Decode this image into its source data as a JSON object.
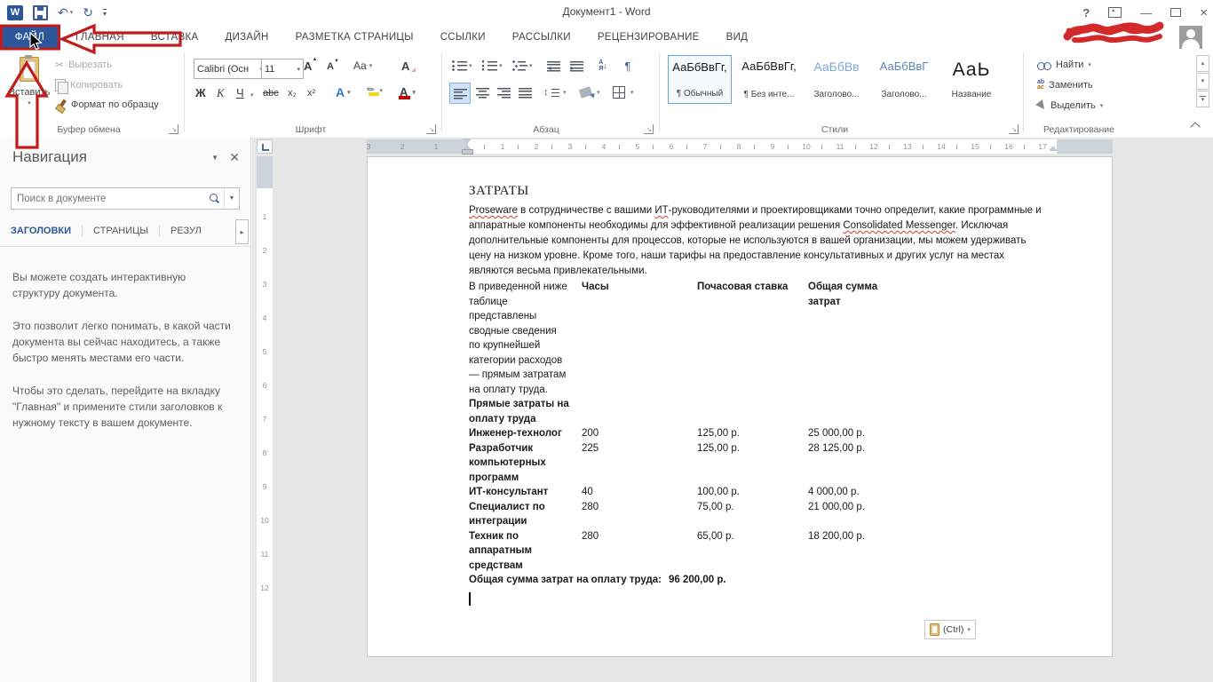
{
  "titlebar": {
    "title": "Документ1 - Word",
    "help": "?"
  },
  "tabs": {
    "file": "ФАЙЛ",
    "items": [
      "ГЛАВНАЯ",
      "ВСТАВКА",
      "ДИЗАЙН",
      "РАЗМЕТКА СТРАНИЦЫ",
      "ССЫЛКИ",
      "РАССЫЛКИ",
      "РЕЦЕНЗИРОВАНИЕ",
      "ВИД"
    ]
  },
  "ribbon": {
    "clipboard": {
      "paste": "Вставить",
      "cut": "Вырезать",
      "copy": "Копировать",
      "format_painter": "Формат по образцу",
      "group": "Буфер обмена"
    },
    "font": {
      "name": "Calibri (Осн",
      "size": "11",
      "bold": "Ж",
      "italic": "К",
      "underline": "Ч",
      "strike": "abc",
      "subscript": "x₂",
      "superscript": "x²",
      "change_case": "Aa",
      "grow": "А",
      "shrink": "А",
      "clear": "А",
      "effects": "А",
      "color_letter": "А",
      "group": "Шрифт"
    },
    "paragraph": {
      "group": "Абзац",
      "pilcrow": "¶",
      "sort_a": "А",
      "sort_b": "Я"
    },
    "styles": {
      "group": "Стили",
      "items": [
        {
          "preview": "АаБбВвГг,",
          "name": "¶ Обычный"
        },
        {
          "preview": "АаБбВвГг,",
          "name": "¶ Без инте..."
        },
        {
          "preview": "АаБбВв",
          "name": "Заголово..."
        },
        {
          "preview": "АаБбВвГ",
          "name": "Заголово..."
        },
        {
          "preview": "АаЬ",
          "name": "Название"
        }
      ]
    },
    "editing": {
      "find": "Найти",
      "replace": "Заменить",
      "select": "Выделить",
      "group": "Редактирование"
    }
  },
  "navigation": {
    "title": "Навигация",
    "search_placeholder": "Поиск в документе",
    "tabs": [
      "ЗАГОЛОВКИ",
      "СТРАНИЦЫ",
      "РЕЗУЛ"
    ],
    "paragraphs": [
      "Вы можете создать интерактивную структуру документа.",
      "Это позволит легко понимать, в какой части документа вы сейчас находитесь, а также быстро менять местами его части.",
      "Чтобы это сделать, перейдите на вкладку \"Главная\" и примените стили заголовков к нужному тексту в вашем документе."
    ]
  },
  "document": {
    "heading": "ЗАТРАТЫ",
    "intro": [
      {
        "text": "Proseware"
      },
      {
        "text": " в сотрудничестве с вашими "
      },
      {
        "text": "ИТ"
      },
      {
        "text": "-руководителями и проектировщиками точно определит, какие программные и аппаратные компоненты необходимы для эффективной реализации решения "
      },
      {
        "text": "Consolidated Messenger"
      },
      {
        "text": ". Исключая дополнительные компоненты для процессов, которые не используются в вашей организации, мы можем удерживать цену на низком уровне. Кроме того, наши тарифы на предоставление консультативных и других услуг на местах являются весьма привлекательными."
      }
    ],
    "table": {
      "col1_intro": "В приведенной ниже таблице представлены сводные сведения по крупнейшей категории расходов — прямым затратам на оплату труда.",
      "headers": [
        "Часы",
        "Почасовая ставка",
        "Общая сумма затрат"
      ],
      "section": "Прямые затраты на оплату труда",
      "rows": [
        {
          "role": "Инженер-технолог",
          "hours": "200",
          "rate": "125,00 р.",
          "total": "25 000,00 р."
        },
        {
          "role": "Разработчик компьютерных программ",
          "hours": "225",
          "rate": "125,00 р.",
          "total": "28 125,00 р."
        },
        {
          "role": "ИТ-консультант",
          "hours": "40",
          "rate": "100,00 р.",
          "total": "4 000,00 р."
        },
        {
          "role": "Специалист по интеграции",
          "hours": "280",
          "rate": "75,00 р.",
          "total": "21 000,00 р."
        },
        {
          "role": "Техник по аппаратным средствам",
          "hours": "280",
          "rate": "65,00 р.",
          "total": "18 200,00 р."
        }
      ],
      "total_label": "Общая сумма затрат на оплату труда:",
      "total_value": "96 200,00 р."
    },
    "paste_badge": "(Ctrl)"
  },
  "ruler": {
    "h_left": [
      "3",
      "2",
      "1"
    ],
    "h_right": [
      "1",
      "2",
      "3",
      "4",
      "5",
      "6",
      "7",
      "8",
      "9",
      "10",
      "11",
      "12",
      "13",
      "14",
      "15",
      "16",
      "17"
    ],
    "vertical": [
      "1",
      "2",
      "3",
      "4",
      "5",
      "6",
      "7",
      "8",
      "9",
      "10",
      "11",
      "12"
    ]
  },
  "colors": {
    "accent": "#2b579a",
    "annotation": "#c11b1b",
    "squiggle": "#d03b2f"
  }
}
